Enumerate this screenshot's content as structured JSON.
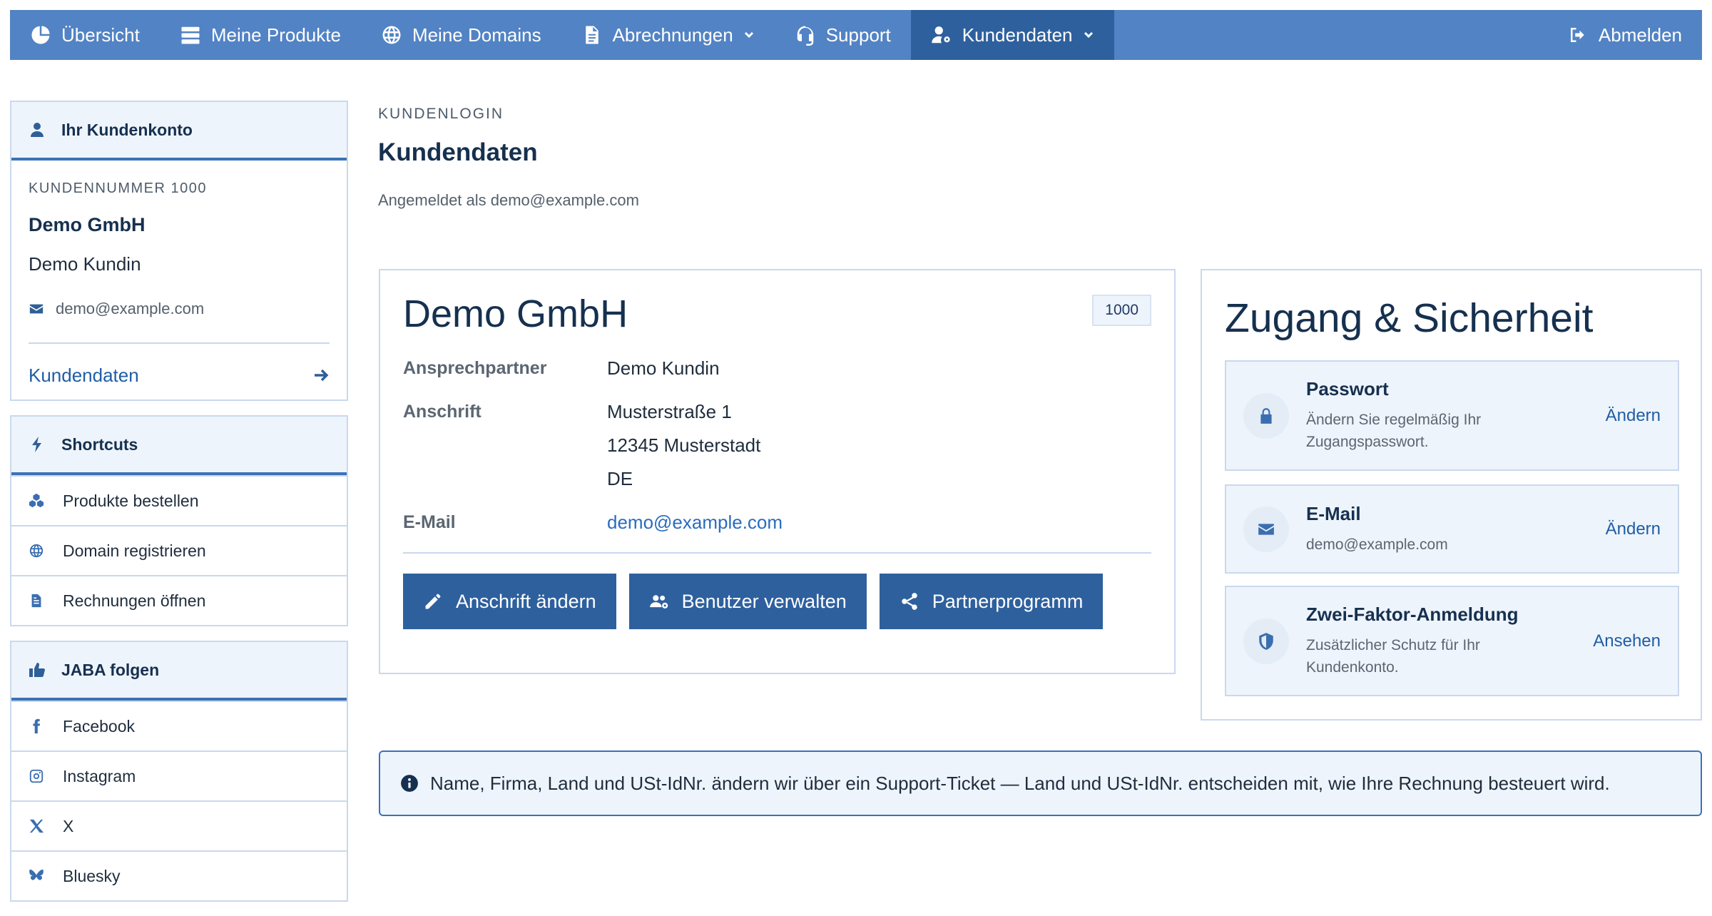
{
  "nav": {
    "items": [
      {
        "label": "Übersicht",
        "icon": "pie-chart-icon"
      },
      {
        "label": "Meine Produkte",
        "icon": "server-icon"
      },
      {
        "label": "Meine Domains",
        "icon": "globe-icon"
      },
      {
        "label": "Abrechnungen",
        "icon": "document-icon",
        "dropdown": true
      },
      {
        "label": "Support",
        "icon": "headset-icon"
      },
      {
        "label": "Kundendaten",
        "icon": "user-gear-icon",
        "dropdown": true,
        "active": true
      }
    ],
    "logout": {
      "label": "Abmelden",
      "icon": "logout-icon"
    }
  },
  "sidebar": {
    "account": {
      "title": "Ihr Kundenkonto",
      "number_label": "KUNDENNUMMER 1000",
      "company": "Demo GmbH",
      "name": "Demo Kundin",
      "email": "demo@example.com",
      "link": "Kundendaten"
    },
    "shortcuts": {
      "title": "Shortcuts",
      "items": [
        {
          "label": "Produkte bestellen",
          "icon": "cubes-icon"
        },
        {
          "label": "Domain registrieren",
          "icon": "globe-icon"
        },
        {
          "label": "Rechnungen öffnen",
          "icon": "invoice-icon"
        }
      ]
    },
    "follow": {
      "title": "JABA folgen",
      "items": [
        {
          "label": "Facebook",
          "icon": "facebook-icon"
        },
        {
          "label": "Instagram",
          "icon": "instagram-icon"
        },
        {
          "label": "X",
          "icon": "x-icon"
        },
        {
          "label": "Bluesky",
          "icon": "bluesky-icon"
        }
      ]
    }
  },
  "main": {
    "kicker": "KUNDENLOGIN",
    "title": "Kundendaten",
    "logged_in": "Angemeldet als demo@example.com"
  },
  "customer_card": {
    "company": "Demo GmbH",
    "badge": "1000",
    "contact_label": "Ansprechpartner",
    "contact_value": "Demo Kundin",
    "address_label": "Anschrift",
    "address_lines": [
      "Musterstraße 1",
      "12345 Musterstadt",
      "DE"
    ],
    "email_label": "E-Mail",
    "email_value": "demo@example.com",
    "buttons": {
      "address": "Anschrift ändern",
      "users": "Benutzer verwalten",
      "partner": "Partnerprogramm"
    }
  },
  "security": {
    "title": "Zugang & Sicherheit",
    "items": [
      {
        "label": "Passwort",
        "desc": "Ändern Sie regelmäßig Ihr Zugangspasswort.",
        "action": "Ändern",
        "icon": "lock-icon"
      },
      {
        "label": "E-Mail",
        "desc": "demo@example.com",
        "action": "Ändern",
        "icon": "envelope-icon"
      },
      {
        "label": "Zwei-Faktor-Anmeldung",
        "desc": "Zusätzlicher Schutz für Ihr Kundenkonto.",
        "action": "Ansehen",
        "icon": "shield-icon"
      }
    ]
  },
  "info": {
    "text": "Name, Firma, Land und USt-IdNr. ändern wir über ein Support-Ticket — Land und USt-IdNr. entscheiden mit, wie Ihre Rechnung besteuert wird."
  },
  "colors": {
    "nav_bg": "#5283c4",
    "nav_active": "#2e609e",
    "primary_button": "#2e609e",
    "heading": "#16304f",
    "link": "#2a6cc0",
    "panel_border": "#c9d9ee",
    "panel_tint": "#eef4fb"
  }
}
